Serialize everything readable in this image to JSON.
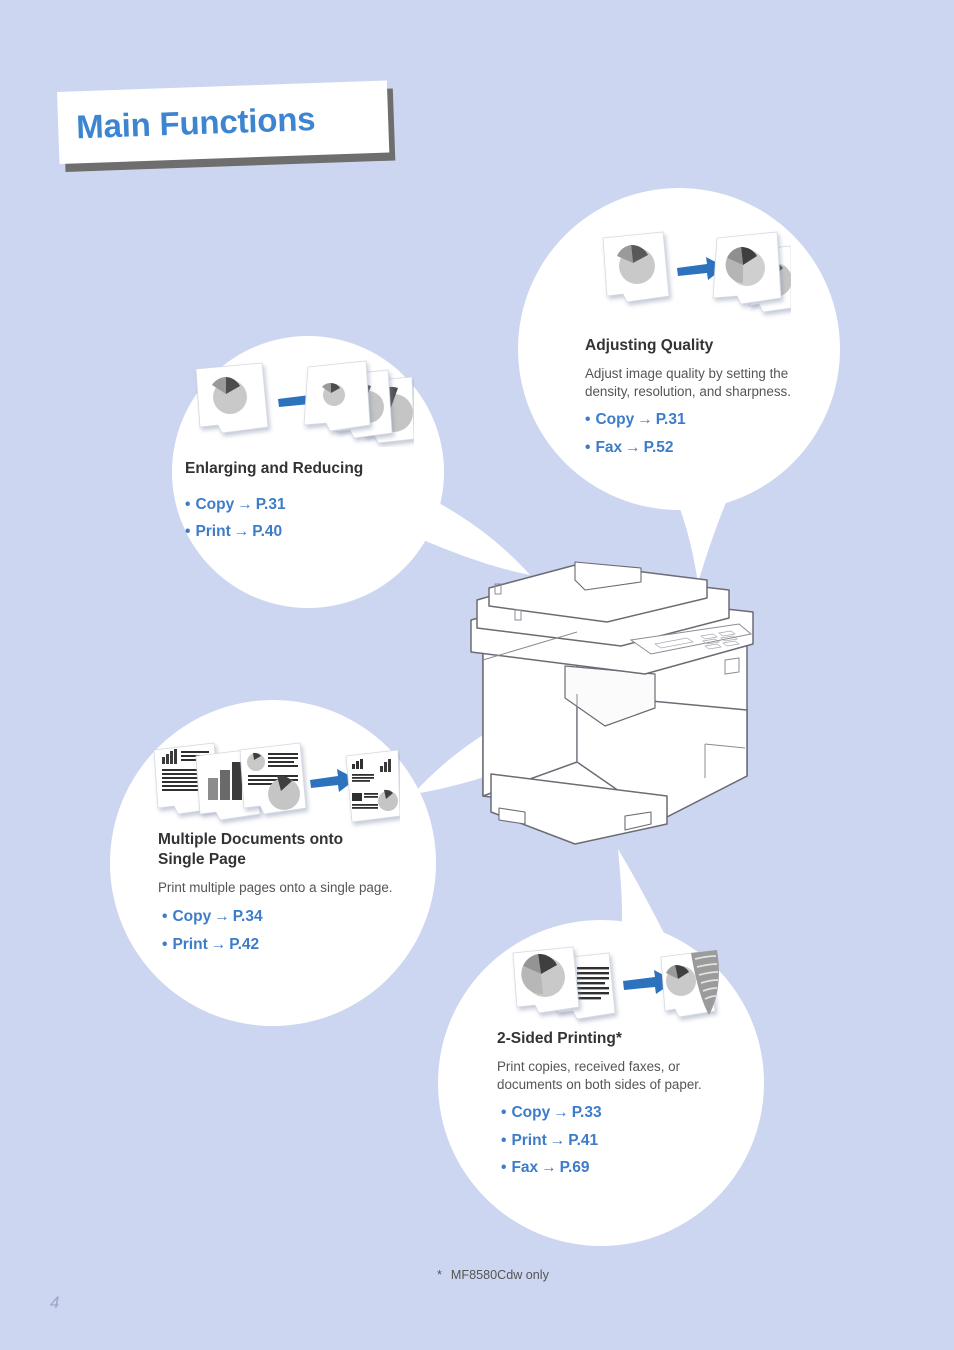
{
  "page": {
    "background_color": "#ccd6f0",
    "title": "Main Functions",
    "title_color": "#3d85d0",
    "folio": "4",
    "footnote_marker": "*",
    "footnote_text": "MF8580Cdw only"
  },
  "accent": {
    "link_blue": "#3d7cc9",
    "arrow_blue": "#2d72bd",
    "heading_dark": "#333333",
    "body_gray": "#555555"
  },
  "bubbles": [
    {
      "id": "enlarging-reducing",
      "title": "Enlarging and Reducing",
      "body": "",
      "icon": "scaled-pages-arrow-icon",
      "links": [
        {
          "label": "Copy",
          "arrow": "→",
          "page": "P.31"
        },
        {
          "label": "Print",
          "arrow": "→",
          "page": "P.40"
        }
      ]
    },
    {
      "id": "adjusting-quality",
      "title": "Adjusting Quality",
      "body": "Adjust image quality by setting the density, resolution, and sharpness.",
      "icon": "quality-pages-arrow-icon",
      "links": [
        {
          "label": "Copy",
          "arrow": "→",
          "page": "P.31"
        },
        {
          "label": "Fax",
          "arrow": "→",
          "page": "P.52"
        }
      ]
    },
    {
      "id": "multiple-documents-single-page",
      "title": "Multiple Documents onto Single Page",
      "title_line1": "Multiple Documents onto",
      "title_line2": "Single Page",
      "body": "Print multiple pages onto a single page.",
      "icon": "nup-pages-arrow-icon",
      "links": [
        {
          "label": "Copy",
          "arrow": "→",
          "page": "P.34"
        },
        {
          "label": "Print",
          "arrow": "→",
          "page": "P.42"
        }
      ]
    },
    {
      "id": "two-sided-printing",
      "title": "2-Sided Printing*",
      "body": "Print copies, received faxes, or documents on both sides of paper.",
      "icon": "duplex-pages-arrow-icon",
      "links": [
        {
          "label": "Copy",
          "arrow": "→",
          "page": "P.33"
        },
        {
          "label": "Print",
          "arrow": "→",
          "page": "P.41"
        },
        {
          "label": "Fax",
          "arrow": "→",
          "page": "P.69"
        }
      ]
    }
  ],
  "device": {
    "name": "multifunction-printer-illustration"
  }
}
